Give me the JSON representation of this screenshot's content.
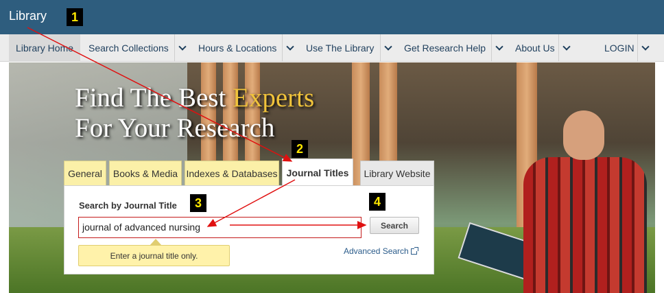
{
  "header": {
    "brand": "Library"
  },
  "nav": {
    "items": [
      "Library Home",
      "Search Collections",
      "Hours & Locations",
      "Use The Library",
      "Get Research Help",
      "About Us",
      "LOGIN"
    ]
  },
  "hero": {
    "line1_a": "Find The Best ",
    "line1_b": "Experts",
    "line2": "For Your Research"
  },
  "tabs": [
    "General",
    "Books & Media",
    "Indexes & Databases",
    "Journal Titles",
    "Library Website"
  ],
  "search": {
    "label": "Search by Journal Title",
    "value": "journal of advanced nursing",
    "button": "Search",
    "hint": "Enter a journal title only.",
    "advanced": "Advanced Search"
  },
  "annotations": [
    "1",
    "2",
    "3",
    "4"
  ],
  "colors": {
    "topbar": "#2e5d7e",
    "accent_gold": "#f0c33b",
    "annotation_red": "#e01010"
  }
}
